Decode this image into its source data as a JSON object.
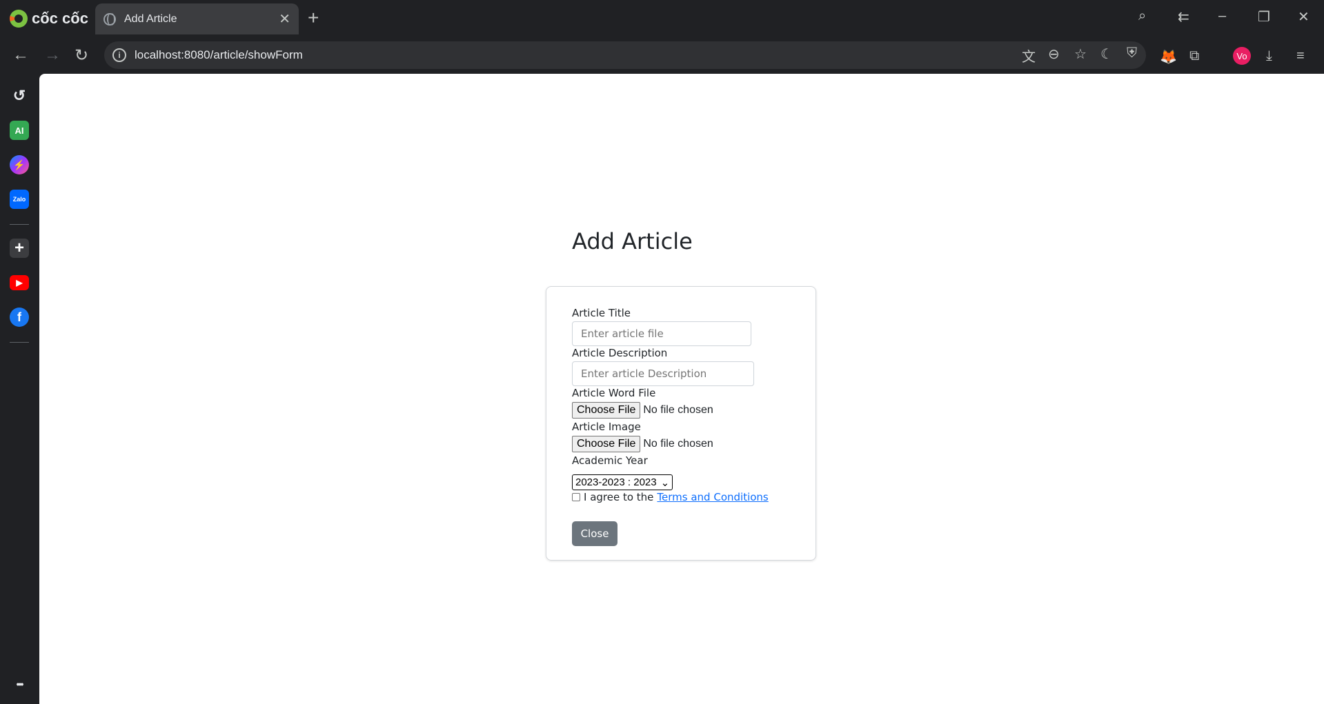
{
  "browser": {
    "brand": "cốc cốc",
    "tab_title": "Add Article",
    "tab_close": "✕",
    "new_tab": "+",
    "url": "localhost:8080/article/showForm",
    "avatar_initials": "Vo",
    "icons": [
      "back-icon",
      "forward-icon",
      "reload-icon",
      "info-icon",
      "translate-icon",
      "zoom-out-icon",
      "star-icon",
      "dark-mode-icon",
      "shield-icon",
      "metamask-icon",
      "extensions-icon",
      "avatar",
      "download-icon",
      "menu-icon"
    ]
  },
  "sidebar": {
    "items": [
      {
        "name": "history-icon",
        "label": "↺",
        "color": "#202124"
      },
      {
        "name": "ai-icon",
        "label": "AI",
        "color": "#34a853"
      },
      {
        "name": "messenger-icon",
        "label": "⚡",
        "color": "#a033ff"
      },
      {
        "name": "zalo-icon",
        "label": "Zalo",
        "color": "#0068ff"
      },
      {
        "name": "add-icon",
        "label": "+",
        "color": "#3c3d40"
      },
      {
        "name": "youtube-icon",
        "label": "▶",
        "color": "#ff0000"
      },
      {
        "name": "facebook-icon",
        "label": "f",
        "color": "#1877f2"
      },
      {
        "name": "more-icon",
        "label": "•••",
        "color": "#202124"
      }
    ]
  },
  "page": {
    "title": "Add Article",
    "form": {
      "title_label": "Article Title",
      "title_placeholder": "Enter article file",
      "description_label": "Article Description",
      "description_placeholder": "Enter article Description",
      "word_file_label": "Article Word File",
      "image_label": "Article Image",
      "choose_file": "Choose File",
      "no_file": "No file chosen",
      "year_label": "Academic Year",
      "year_selected": "2023-2023 : 2023",
      "agree_text": "I agree to the",
      "terms_link": "Terms and Conditions",
      "close_button": "Close"
    }
  }
}
